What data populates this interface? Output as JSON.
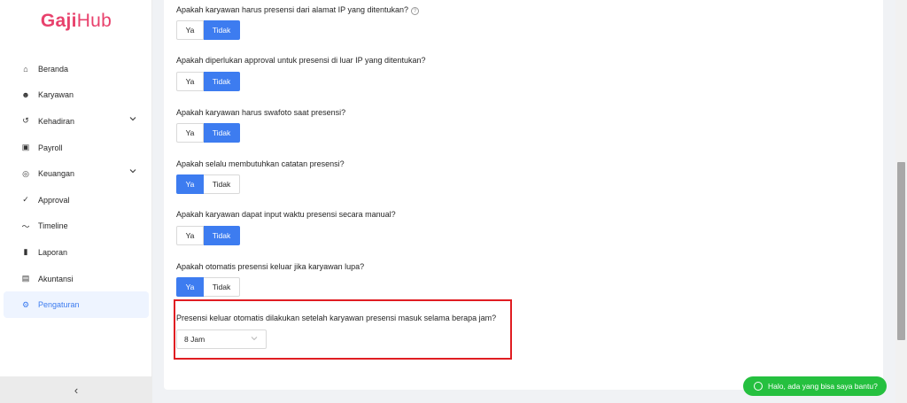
{
  "brand": {
    "logo_part1": "Gaji",
    "logo_part2": "Hub"
  },
  "sidebar": {
    "items": [
      {
        "label": "Beranda",
        "icon": "home-icon",
        "glyph": "⌂"
      },
      {
        "label": "Karyawan",
        "icon": "users-icon",
        "glyph": "☻"
      },
      {
        "label": "Kehadiran",
        "icon": "history-icon",
        "glyph": "↺"
      },
      {
        "label": "Payroll",
        "icon": "payroll-icon",
        "glyph": "▣"
      },
      {
        "label": "Keuangan",
        "icon": "money-icon",
        "glyph": "◎"
      },
      {
        "label": "Approval",
        "icon": "check-circle-icon",
        "glyph": "✓"
      },
      {
        "label": "Timeline",
        "icon": "timeline-icon",
        "glyph": "〜"
      },
      {
        "label": "Laporan",
        "icon": "bar-chart-icon",
        "glyph": "▮"
      },
      {
        "label": "Akuntansi",
        "icon": "book-icon",
        "glyph": "▤"
      },
      {
        "label": "Pengaturan",
        "icon": "gear-icon",
        "glyph": "⚙"
      }
    ],
    "collapse_glyph": "‹"
  },
  "settings": {
    "q1": {
      "text": "Apakah karyawan harus presensi dari alamat IP yang ditentukan?",
      "selected": "Tidak"
    },
    "q2": {
      "text": "Apakah diperlukan approval untuk presensi di luar IP yang ditentukan?",
      "selected": "Tidak"
    },
    "q3": {
      "text": "Apakah karyawan harus swafoto saat presensi?",
      "selected": "Tidak"
    },
    "q4": {
      "text": "Apakah selalu membutuhkan catatan presensi?",
      "selected": "Ya"
    },
    "q5": {
      "text": "Apakah karyawan dapat input waktu presensi secara manual?",
      "selected": "Tidak"
    },
    "q6": {
      "text": "Apakah otomatis presensi keluar jika karyawan lupa?",
      "selected": "Ya"
    },
    "q7": {
      "text": "Presensi keluar otomatis dilakukan setelah karyawan presensi masuk selama berapa jam?",
      "value": "8 Jam"
    },
    "option_yes": "Ya",
    "option_no": "Tidak",
    "help_glyph": "?"
  },
  "chat": {
    "label": "Halo, ada yang bisa saya bantu?"
  },
  "colors": {
    "accent": "#3d7cf0",
    "brand": "#e8416c",
    "highlight": "#e01d22",
    "chat": "#25c03f"
  }
}
